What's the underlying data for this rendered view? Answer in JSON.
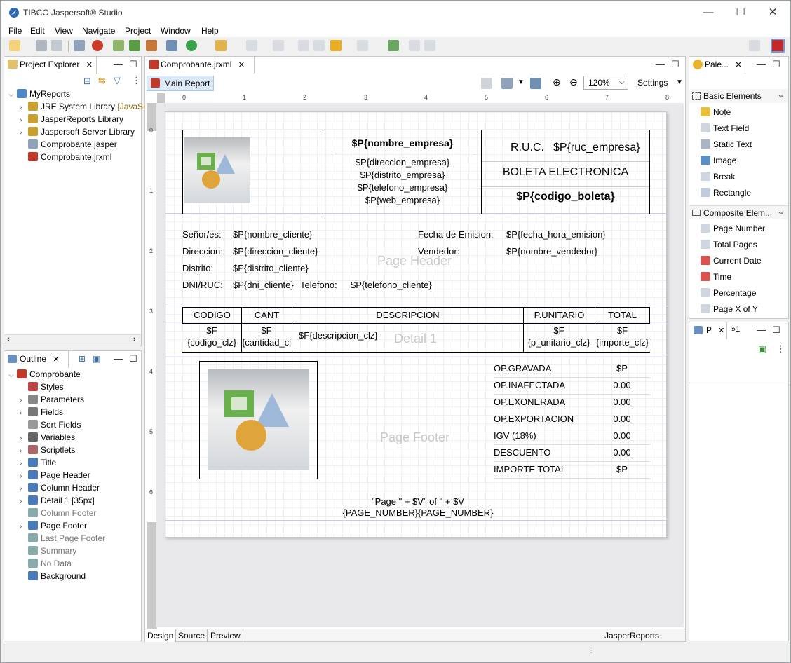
{
  "app": {
    "title": "TIBCO Jaspersoft® Studio"
  },
  "menu": [
    "File",
    "Edit",
    "View",
    "Navigate",
    "Project",
    "Window",
    "Help"
  ],
  "project_explorer": {
    "tab": "Project Explorer",
    "root": "MyReports",
    "items": [
      "JRE System Library",
      "JasperReports Library",
      "Jaspersoft Server Library",
      "Comprobante.jasper",
      "Comprobante.jrxml"
    ],
    "jre_suffix": "[JavaSE-"
  },
  "outline": {
    "tab": "Outline",
    "root": "Comprobante",
    "items": [
      "Styles",
      "Parameters",
      "Fields",
      "Sort Fields",
      "Variables",
      "Scriptlets",
      "Title",
      "Page Header",
      "Column Header",
      "Detail 1 [35px]",
      "Column Footer",
      "Page Footer",
      "Last Page Footer",
      "Summary",
      "No Data",
      "Background"
    ]
  },
  "editor": {
    "tab": "Comprobante.jrxml",
    "main_report": "Main Report",
    "zoom": "120%",
    "settings": "Settings",
    "bottom_tabs": [
      "Design",
      "Source",
      "Preview"
    ],
    "status_right": "JasperReports Library"
  },
  "report": {
    "header": {
      "empresa": "$P{nombre_empresa}",
      "direccion": "$P{direccion_empresa}",
      "distrito": "$P{distrito_empresa}",
      "telefono": "$P{telefono_empresa}",
      "web": "$P{web_empresa}",
      "ruc_label": "R.U.C.",
      "ruc": "$P{ruc_empresa}",
      "boleta": "BOLETA ELECTRONICA",
      "codigo": "$P{codigo_boleta}"
    },
    "cliente": {
      "senor_lbl": "Señor/es:",
      "senor": "$P{nombre_cliente}",
      "dir_lbl": "Direccion:",
      "dir": "$P{direccion_cliente}",
      "dist_lbl": "Distrito:",
      "dist": "$P{distrito_cliente}",
      "dni_lbl": "DNI/RUC:",
      "dni": "$P{dni_cliente}",
      "tel_lbl": "Telefono:",
      "tel": "$P{telefono_cliente}",
      "fecha_lbl": "Fecha de Emision:",
      "fecha": "$P{fecha_hora_emision}",
      "vend_lbl": "Vendedor:",
      "vend": "$P{nombre_vendedor}"
    },
    "bands": {
      "page_header": "Page Header",
      "detail": "Detail 1",
      "page_footer": "Page Footer"
    },
    "columns": [
      "CODIGO",
      "CANT",
      "DESCRIPCION",
      "P.UNITARIO",
      "TOTAL"
    ],
    "detail": {
      "cod1": "$F",
      "cod2": "{codigo_clz}",
      "cant1": "$F",
      "cant2": "{cantidad_cl",
      "desc": "$F{descripcion_clz}",
      "pu1": "$F",
      "pu2": "{p_unitario_clz}",
      "tot1": "$F",
      "tot2": "{importe_clz}"
    },
    "totals": [
      [
        "OP.GRAVADA",
        "$P"
      ],
      [
        "OP.INAFECTADA",
        "0.00"
      ],
      [
        "OP.EXONERADA",
        "0.00"
      ],
      [
        "OP.EXPORTACION",
        "0.00"
      ],
      [
        "IGV (18%)",
        "0.00"
      ],
      [
        "DESCUENTO",
        "0.00"
      ],
      [
        "IMPORTE TOTAL",
        "$P"
      ]
    ],
    "pagenum": {
      "a1": "\"Page \" + $V",
      "a2": "{PAGE_NUMBER}",
      "b1": "\" of \" + $V",
      "b2": "{PAGE_NUMBER}"
    }
  },
  "palette": {
    "tab": "Pale...",
    "basic_title": "Basic Elements",
    "basic": [
      "Note",
      "Text Field",
      "Static Text",
      "Image",
      "Break",
      "Rectangle"
    ],
    "composite_title": "Composite Elem...",
    "composite": [
      "Page Number",
      "Total Pages",
      "Current Date",
      "Time",
      "Percentage",
      "Page X of Y"
    ],
    "p_tab": "P",
    "p_tab2": "»1"
  },
  "ruler_nums": [
    "0",
    "1",
    "2",
    "3",
    "4",
    "5",
    "6",
    "7",
    "8"
  ]
}
